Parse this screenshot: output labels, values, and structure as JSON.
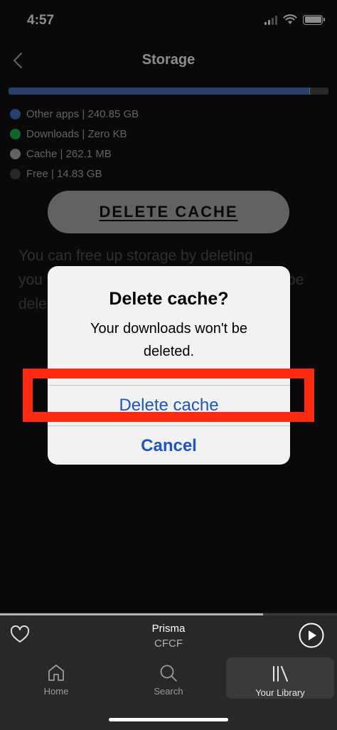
{
  "status_bar": {
    "time": "4:57"
  },
  "nav": {
    "title": "Storage"
  },
  "storage": {
    "legend": [
      {
        "label": "Other apps | 240.85 GB",
        "color": "#4a73c3"
      },
      {
        "label": "Downloads | Zero KB",
        "color": "#1db954"
      },
      {
        "label": "Cache | 262.1 MB",
        "color": "#b3b3b3"
      },
      {
        "label": "Free | 14.83 GB",
        "color": "#4a4a4a"
      }
    ],
    "delete_button_label": "DELETE CACHE",
    "info_lines": [
      "You can free up storage by deleting",
      "you",
      "dele"
    ],
    "info_trailing": "be"
  },
  "alert": {
    "title": "Delete cache?",
    "message": "Your downloads won't be deleted.",
    "confirm_label": "Delete cache",
    "cancel_label": "Cancel"
  },
  "now_playing": {
    "title": "Prisma",
    "artist": "CFCF"
  },
  "tabs": [
    {
      "label": "Home",
      "icon": "home-icon"
    },
    {
      "label": "Search",
      "icon": "search-icon"
    },
    {
      "label": "Your Library",
      "icon": "library-icon",
      "active": true
    }
  ],
  "colors": {
    "accent_blue": "#1c55c4",
    "highlight_red": "#ff2a12"
  }
}
